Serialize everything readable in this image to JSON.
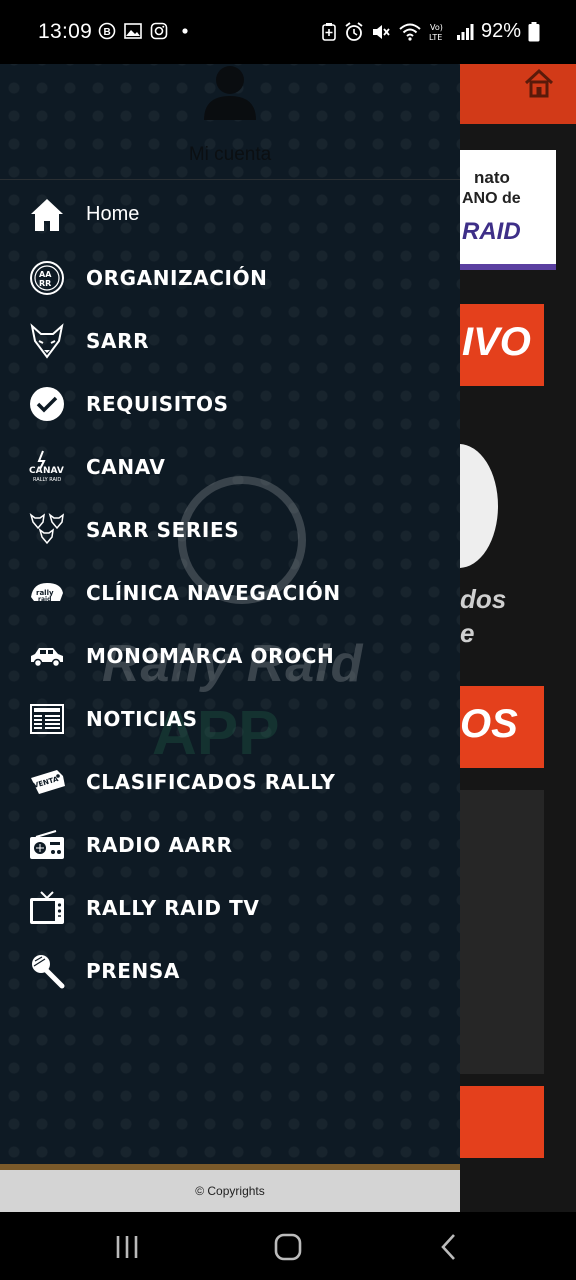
{
  "status_bar": {
    "time": "13:09",
    "battery": "92%",
    "left_icons": [
      "b-circle-icon",
      "gallery-icon",
      "instagram-icon",
      "dot-icon"
    ],
    "right_icons": [
      "battery-saver-icon",
      "alarm-icon",
      "mute-icon",
      "wifi-icon",
      "volte-icon",
      "signal-icon",
      "battery-icon"
    ]
  },
  "drawer": {
    "account_label": "Mi cuenta",
    "menu": [
      {
        "label": "Home",
        "icon": "home-icon"
      },
      {
        "label": "ORGANIZACIÓN",
        "icon": "aarr-logo-icon"
      },
      {
        "label": "SARR",
        "icon": "fox-icon"
      },
      {
        "label": "REQUISITOS",
        "icon": "check-circle-icon"
      },
      {
        "label": "CANAV",
        "icon": "canav-logo-icon"
      },
      {
        "label": "SARR SERIES",
        "icon": "foxes-icon"
      },
      {
        "label": "CLÍNICA NAVEGACIÓN",
        "icon": "rally-logo-icon"
      },
      {
        "label": "MONOMARCA OROCH",
        "icon": "car-icon"
      },
      {
        "label": "NOTICIAS",
        "icon": "newspaper-icon"
      },
      {
        "label": "CLASIFICADOS RALLY",
        "icon": "venta-tag-icon"
      },
      {
        "label": "RADIO AARR",
        "icon": "radio-icon"
      },
      {
        "label": "RALLY RAID TV",
        "icon": "tv-icon"
      },
      {
        "label": "PRENSA",
        "icon": "microphone-icon"
      }
    ],
    "footer": "© Copyrights",
    "watermark": {
      "small": "Rally Raid",
      "line1": "Rally Raid",
      "line2": "APP"
    }
  },
  "background_app": {
    "banner_line1": "nato",
    "banner_line2": "ANO de",
    "banner_line3": "RAID",
    "tile1_text": "IVO",
    "text_line1": "dos",
    "text_line2": "e",
    "tile2_text": "OS"
  },
  "colors": {
    "drawer_bg": "#0e1a24",
    "accent_red": "#e4401c",
    "footer_bg": "#d4d4d4"
  }
}
